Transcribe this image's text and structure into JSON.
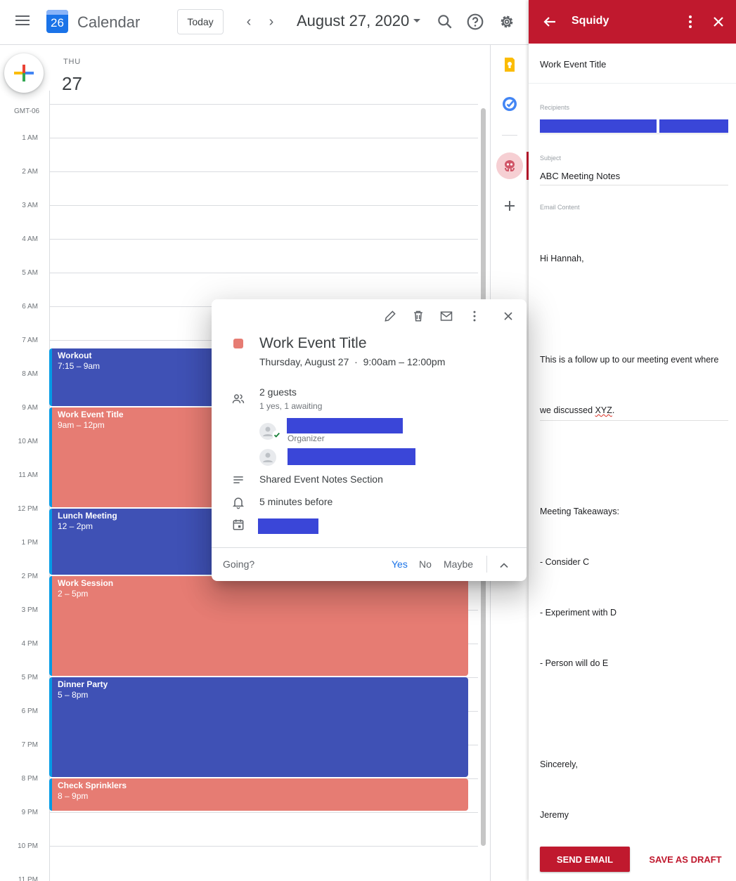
{
  "header": {
    "logo_day": "26",
    "app_title": "Calendar",
    "today_label": "Today",
    "prev_arrow": "‹",
    "next_arrow": "›",
    "date_title": "August 27, 2020",
    "icons": [
      "menu-icon",
      "search-icon",
      "help-icon",
      "settings-icon"
    ]
  },
  "day_column": {
    "weekday": "THU",
    "day": "27",
    "timezone": "GMT-06",
    "hours": [
      "1 AM",
      "2 AM",
      "3 AM",
      "4 AM",
      "5 AM",
      "6 AM",
      "7 AM",
      "8 AM",
      "9 AM",
      "10 AM",
      "11 AM",
      "12 PM",
      "1 PM",
      "2 PM",
      "3 PM",
      "4 PM",
      "5 PM",
      "6 PM",
      "7 PM",
      "8 PM",
      "9 PM",
      "10 PM",
      "11 PM"
    ]
  },
  "events": [
    {
      "title": "Workout",
      "time": "7:15 – 9am",
      "color": "#3f51b5"
    },
    {
      "title": "Work Event Title",
      "time": "9am – 12pm",
      "color": "#e67c73"
    },
    {
      "title": "Lunch Meeting",
      "time": "12 – 2pm",
      "color": "#3f51b5"
    },
    {
      "title": "Work Session",
      "time": "2 – 5pm",
      "color": "#e67c73"
    },
    {
      "title": "Dinner Party",
      "time": "5 – 8pm",
      "color": "#3f51b5"
    },
    {
      "title": "Check Sprinklers",
      "time": "8 – 9pm",
      "color": "#e67c73"
    }
  ],
  "side_strip": {
    "icons": [
      "keep-icon",
      "tasks-icon",
      "squidy-addon-icon",
      "add-addon-icon"
    ]
  },
  "popup": {
    "title": "Work Event Title",
    "date": "Thursday, August 27",
    "dot": "·",
    "time": "9:00am – 12:00pm",
    "guests_count": "2 guests",
    "guests_status": "1 yes, 1 awaiting",
    "organizer_label": "Organizer",
    "notes": "Shared Event Notes Section",
    "reminder": "5 minutes before",
    "going_label": "Going?",
    "rsvp": {
      "yes": "Yes",
      "no": "No",
      "maybe": "Maybe"
    },
    "selected_rsvp": "Yes",
    "accent": "#1a73e8"
  },
  "panel": {
    "title": "Squidy",
    "accent": "#c0192e",
    "event_title": "Work Event Title",
    "recipients_label": "Recipients",
    "subject_label": "Subject",
    "subject_value": "ABC Meeting Notes",
    "content_label": "Email Content",
    "content_greeting": "Hi Hannah,",
    "content_line1": "This is a follow up to our meeting event where",
    "content_line2_pre": "we discussed ",
    "content_line2_word": "XYZ",
    "content_line2_post": ".",
    "takeaways_heading": "Meeting Takeaways:",
    "takeaways": [
      "- Consider C",
      "- Experiment with D",
      "- Person will do E"
    ],
    "signoff": "Sincerely,",
    "signature": "Jeremy",
    "send_label": "SEND EMAIL",
    "draft_label": "SAVE AS DRAFT"
  }
}
